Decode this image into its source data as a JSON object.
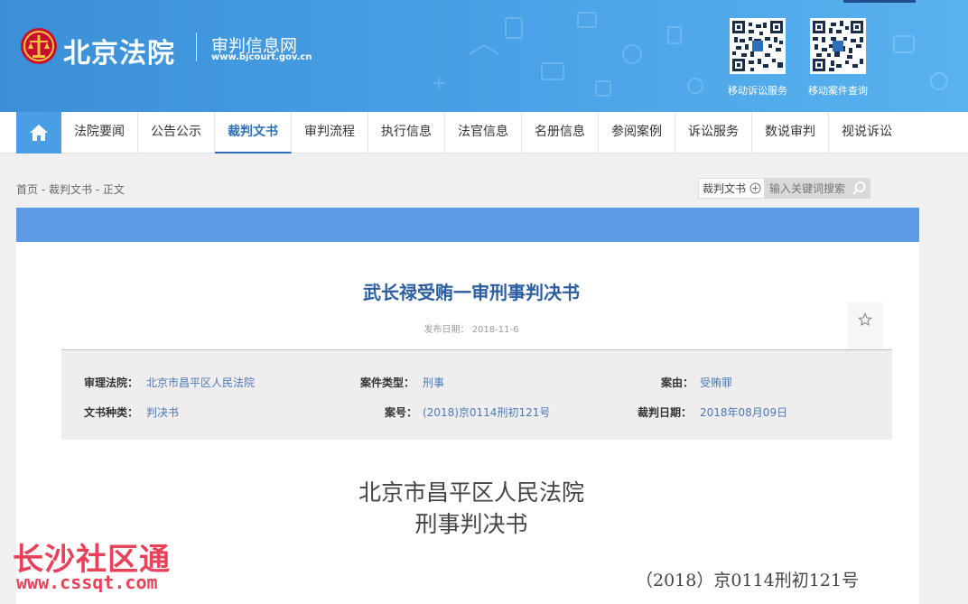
{
  "header": {
    "site_title": "北京法院",
    "site_subtitle": "审判信息网",
    "site_url": "www.bjcourt.gov.cn",
    "qr_codes": [
      {
        "label": "移动诉讼服务"
      },
      {
        "label": "移动案件查询"
      }
    ]
  },
  "nav": {
    "home_icon": "home-icon",
    "items": [
      {
        "label": "法院要闻"
      },
      {
        "label": "公告公示"
      },
      {
        "label": "裁判文书",
        "active": true
      },
      {
        "label": "审判流程"
      },
      {
        "label": "执行信息"
      },
      {
        "label": "法官信息"
      },
      {
        "label": "名册信息"
      },
      {
        "label": "参阅案例"
      },
      {
        "label": "诉讼服务"
      },
      {
        "label": "数说审判"
      },
      {
        "label": "视说诉讼"
      }
    ]
  },
  "breadcrumb": "首页 - 裁判文书 - 正文",
  "search": {
    "category": "裁判文书",
    "placeholder": "输入关键词搜索"
  },
  "document": {
    "title": "武长禄受贿一审刑事判决书",
    "publish_date": "发布日期： 2018-11-6",
    "meta": {
      "court_label": "审理法院：",
      "court_value": "北京市昌平区人民法院",
      "case_type_label": "案件类型：",
      "case_type_value": "刑事",
      "cause_label": "案由：",
      "cause_value": "受贿罪",
      "doc_kind_label": "文书种类：",
      "doc_kind_value": "判决书",
      "case_no_label": "案号：",
      "case_no_value": "(2018)京0114刑初121号",
      "judgment_date_label": "裁判日期：",
      "judgment_date_value": "2018年08月09日"
    },
    "court_name": "北京市昌平区人民法院",
    "doc_type": "刑事判决书",
    "case_number": "（2018）京0114刑初121号"
  },
  "watermark": {
    "text": "长沙社区通",
    "url": "www.cssqt.com"
  },
  "colors": {
    "header_blue": "#4aa3e6",
    "nav_active": "#2f6fb5",
    "card_bar": "#5b9be6",
    "watermark": "#e8425a"
  }
}
